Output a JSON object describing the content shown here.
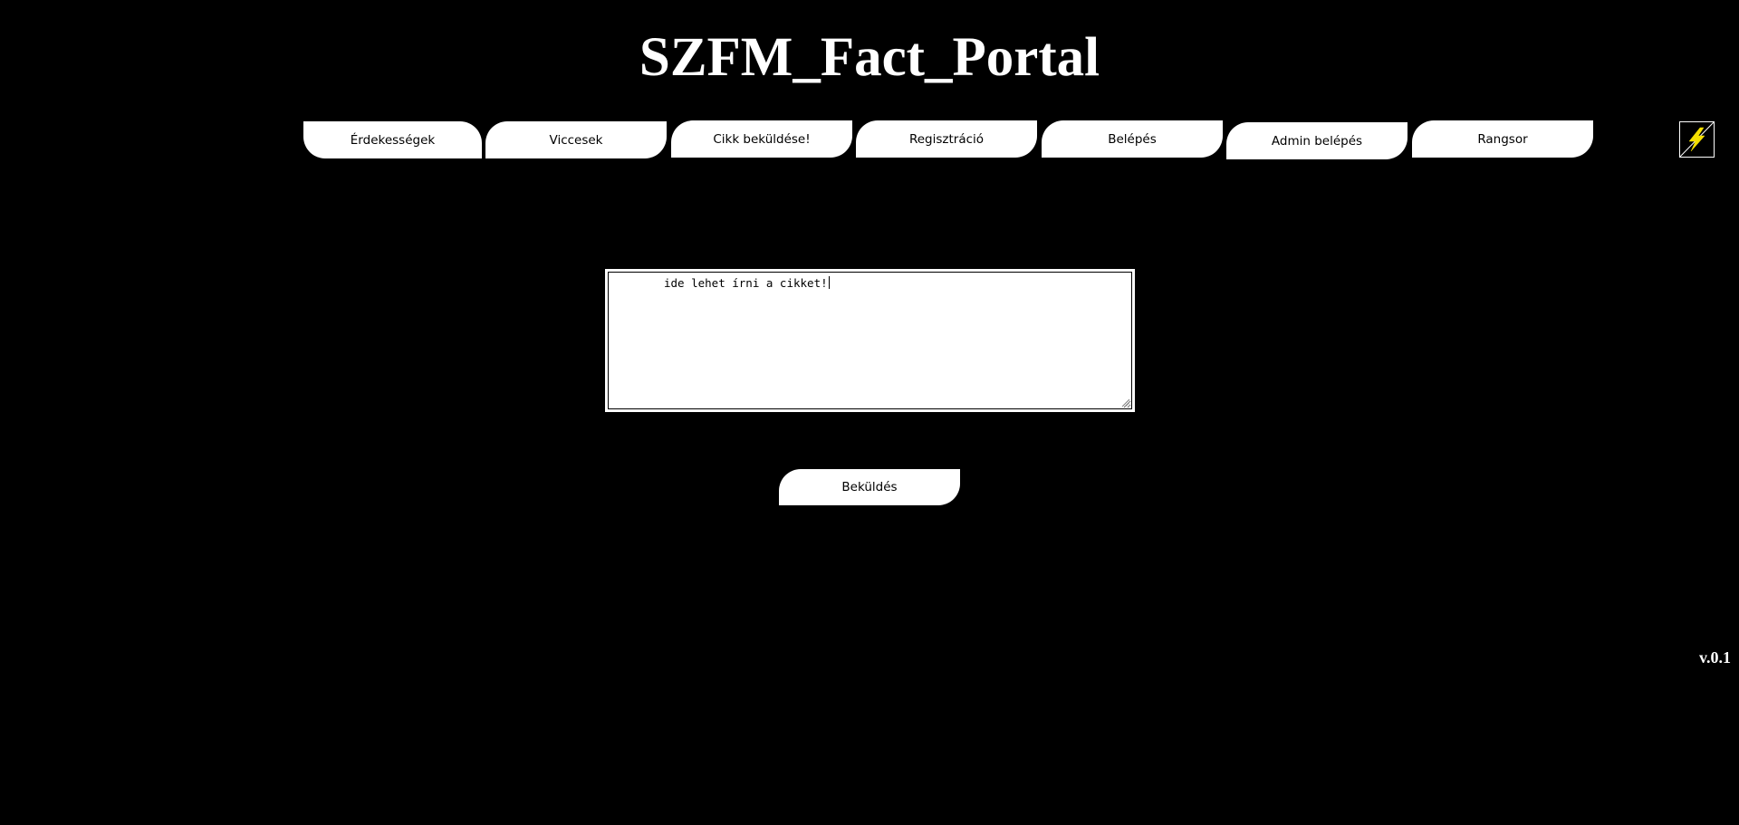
{
  "site": {
    "title": "SZFM_Fact_Portal",
    "version": "v.0.1"
  },
  "nav": {
    "items": [
      {
        "label": "Érdekességek"
      },
      {
        "label": "Viccesek"
      },
      {
        "label": "Cikk beküldése!"
      },
      {
        "label": "Regisztráció"
      },
      {
        "label": "Belépés"
      },
      {
        "label": "Admin belépés"
      },
      {
        "label": "Rangsor"
      }
    ]
  },
  "logo": {
    "icon": "lightning-logo-icon",
    "colors": {
      "bolt": "#f5e000",
      "stroke": "#ffffff"
    }
  },
  "article": {
    "textarea_value": "ide lehet írni a cikket!",
    "submit_label": "Beküldés"
  },
  "colors": {
    "background": "#000000",
    "button": "#ffffff",
    "text_on_dark": "#ffffff",
    "text_on_light": "#000000"
  }
}
